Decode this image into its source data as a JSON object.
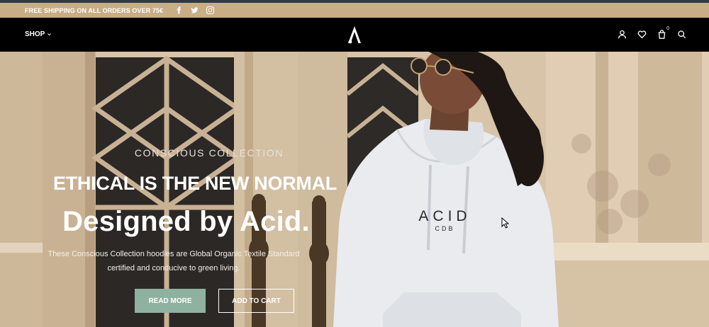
{
  "promo": {
    "text": "FREE SHIPPING ON ALL ORDERS OVER 75€",
    "social_icons": [
      "facebook-icon",
      "twitter-icon",
      "instagram-icon"
    ]
  },
  "header": {
    "shop_label": "SHOP",
    "logo": "A",
    "icons": [
      "user-icon",
      "heart-icon",
      "cart-icon",
      "search-icon"
    ],
    "cart_count": "0"
  },
  "hero": {
    "eyebrow": "CONSCIOUS COLLECTION",
    "headline": "ETHICAL IS THE NEW NORMAL",
    "subhead": "Designed by Acid.",
    "description_line1": "These Conscious Collection hoodies are Global Organic Textile Standard",
    "description_line2": "certified and conducive to green living.",
    "read_more_label": "READ MORE",
    "add_to_cart_label": "ADD TO CART",
    "hoodie_print": "ACID",
    "hoodie_print_sub": "CDB"
  },
  "colors": {
    "promo_bar": "#c9ad84",
    "header_bg": "#000000",
    "read_more_bg": "#8fb1a0",
    "text_light": "#ffffff"
  }
}
